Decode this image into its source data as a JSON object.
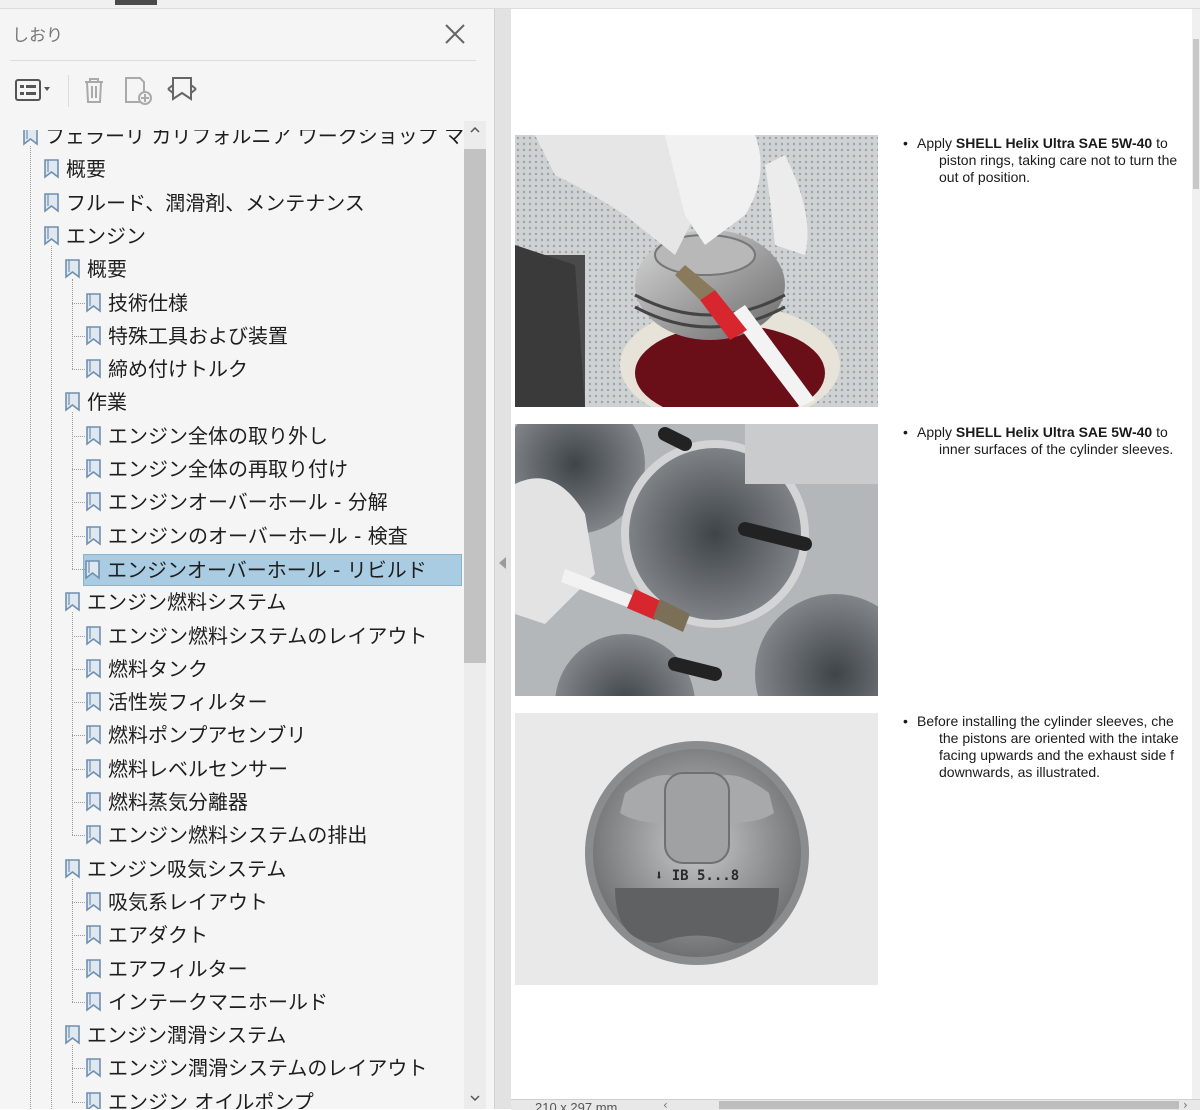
{
  "panel": {
    "title": "しおり",
    "tree": [
      {
        "label": "フェラーリ カリフォルニア ワークショップ マニュアル",
        "level": 0,
        "expander": true
      },
      {
        "label": "概要",
        "level": 1,
        "expander": true
      },
      {
        "label": "フルード、潤滑剤、メンテナンス",
        "level": 1,
        "expander": true
      },
      {
        "label": "エンジン",
        "level": 1,
        "expander": true
      },
      {
        "label": "概要",
        "level": 2,
        "expander": true
      },
      {
        "label": "技術仕様",
        "level": 3,
        "expander": false
      },
      {
        "label": "特殊工具および装置",
        "level": 3,
        "expander": false
      },
      {
        "label": "締め付けトルク",
        "level": 3,
        "expander": false
      },
      {
        "label": "作業",
        "level": 2,
        "expander": true
      },
      {
        "label": "エンジン全体の取り外し",
        "level": 3,
        "expander": false
      },
      {
        "label": "エンジン全体の再取り付け",
        "level": 3,
        "expander": false
      },
      {
        "label": "エンジンオーバーホール - 分解",
        "level": 3,
        "expander": false
      },
      {
        "label": "エンジンのオーバーホール - 検査",
        "level": 3,
        "expander": false
      },
      {
        "label": "エンジンオーバーホール - リビルド",
        "level": 3,
        "expander": false,
        "selected": true
      },
      {
        "label": "エンジン燃料システム",
        "level": 2,
        "expander": true
      },
      {
        "label": "エンジン燃料システムのレイアウト",
        "level": 3,
        "expander": false
      },
      {
        "label": "燃料タンク",
        "level": 3,
        "expander": false
      },
      {
        "label": "活性炭フィルター",
        "level": 3,
        "expander": false
      },
      {
        "label": "燃料ポンプアセンブリ",
        "level": 3,
        "expander": false
      },
      {
        "label": "燃料レベルセンサー",
        "level": 3,
        "expander": false
      },
      {
        "label": "燃料蒸気分離器",
        "level": 3,
        "expander": false
      },
      {
        "label": "エンジン燃料システムの排出",
        "level": 3,
        "expander": false
      },
      {
        "label": "エンジン吸気システム",
        "level": 2,
        "expander": true
      },
      {
        "label": "吸気系レイアウト",
        "level": 3,
        "expander": false
      },
      {
        "label": "エアダクト",
        "level": 3,
        "expander": false
      },
      {
        "label": "エアフィルター",
        "level": 3,
        "expander": false
      },
      {
        "label": "インテークマニホールド",
        "level": 3,
        "expander": false
      },
      {
        "label": "エンジン潤滑システム",
        "level": 2,
        "expander": true
      },
      {
        "label": "エンジン潤滑システムのレイアウト",
        "level": 3,
        "expander": false
      },
      {
        "label": "エンジン オイルポンプ",
        "level": 3,
        "expander": false
      }
    ]
  },
  "doc": {
    "items": [
      {
        "pre": "Apply ",
        "bold": "SHELL Helix Ultra SAE 5W-40",
        "post": " to",
        "lines": [
          "piston rings, taking care not to turn the",
          "out of position."
        ]
      },
      {
        "pre": "Apply ",
        "bold": "SHELL Helix Ultra SAE 5W-40",
        "post": " to",
        "lines": [
          "inner surfaces of the cylinder sleeves."
        ]
      },
      {
        "pre": "Before installing the cylinder sleeves, che",
        "bold": "",
        "post": "",
        "lines": [
          "the pistons are oriented with the intake",
          "facing upwards and the exhaust side f",
          "downwards, as illustrated."
        ]
      }
    ],
    "piston_marking": "⬇ IB 5...8",
    "page_size": "210 x 297 mm"
  },
  "colors": {
    "selection": "#a9cce3",
    "bookmark_icon": "#6f8fb0",
    "brush_red": "#d8262e"
  }
}
